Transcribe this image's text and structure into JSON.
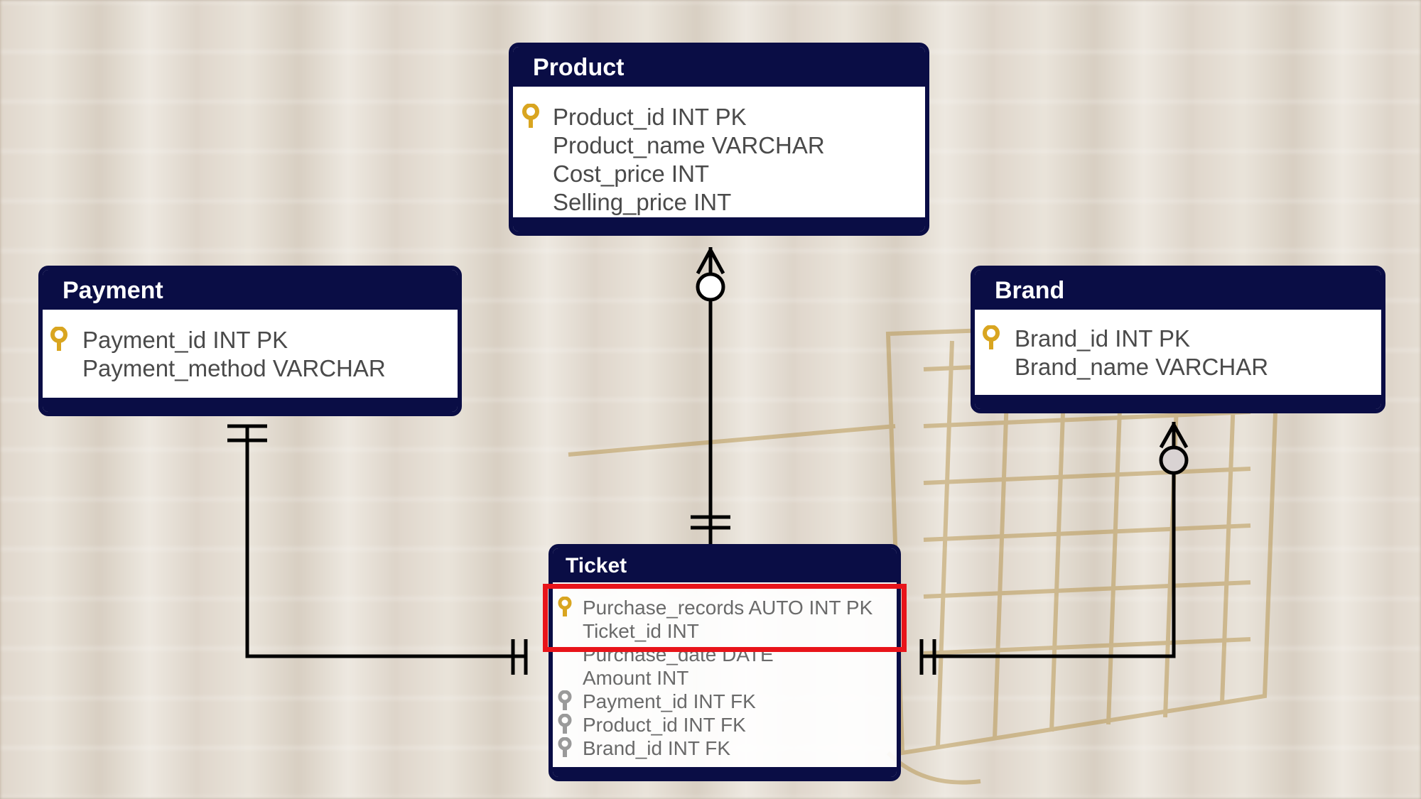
{
  "colors": {
    "header": "#0a0d45",
    "key_primary": "#d9a520",
    "key_foreign": "#9a9a9a",
    "highlight": "#e8141a",
    "line": "#000000"
  },
  "tables": {
    "product": {
      "title": "Product",
      "rows": [
        {
          "text": "Product_id INT PK",
          "key": "primary-key-icon"
        },
        {
          "text": "Product_name VARCHAR",
          "key": ""
        },
        {
          "text": "Cost_price INT",
          "key": ""
        },
        {
          "text": "Selling_price INT",
          "key": ""
        }
      ]
    },
    "payment": {
      "title": "Payment",
      "rows": [
        {
          "text": "Payment_id INT PK",
          "key": "primary-key-icon"
        },
        {
          "text": "Payment_method VARCHAR",
          "key": ""
        }
      ]
    },
    "brand": {
      "title": "Brand",
      "rows": [
        {
          "text": "Brand_id INT PK",
          "key": "primary-key-icon"
        },
        {
          "text": "Brand_name VARCHAR",
          "key": ""
        }
      ]
    },
    "ticket": {
      "title": "Ticket",
      "rows": [
        {
          "text": "Purchase_records AUTO INT PK",
          "key": "primary-key-icon"
        },
        {
          "text": "Ticket_id INT",
          "key": ""
        },
        {
          "text": "Purchase_date DATE",
          "key": ""
        },
        {
          "text": "Amount INT",
          "key": ""
        },
        {
          "text": "Payment_id INT FK",
          "key": "foreign-key-icon"
        },
        {
          "text": "Product_id INT FK",
          "key": "foreign-key-icon"
        },
        {
          "text": "Brand_id INT FK",
          "key": "foreign-key-icon"
        }
      ]
    }
  },
  "relationships": [
    {
      "from": "Ticket",
      "to": "Product",
      "from_cardinality": "one-and-only-one",
      "to_cardinality": "zero-or-many"
    },
    {
      "from": "Ticket",
      "to": "Payment",
      "from_cardinality": "one-and-only-one",
      "to_cardinality": "one-and-only-one"
    },
    {
      "from": "Ticket",
      "to": "Brand",
      "from_cardinality": "one-and-only-one",
      "to_cardinality": "zero-or-many"
    }
  ]
}
